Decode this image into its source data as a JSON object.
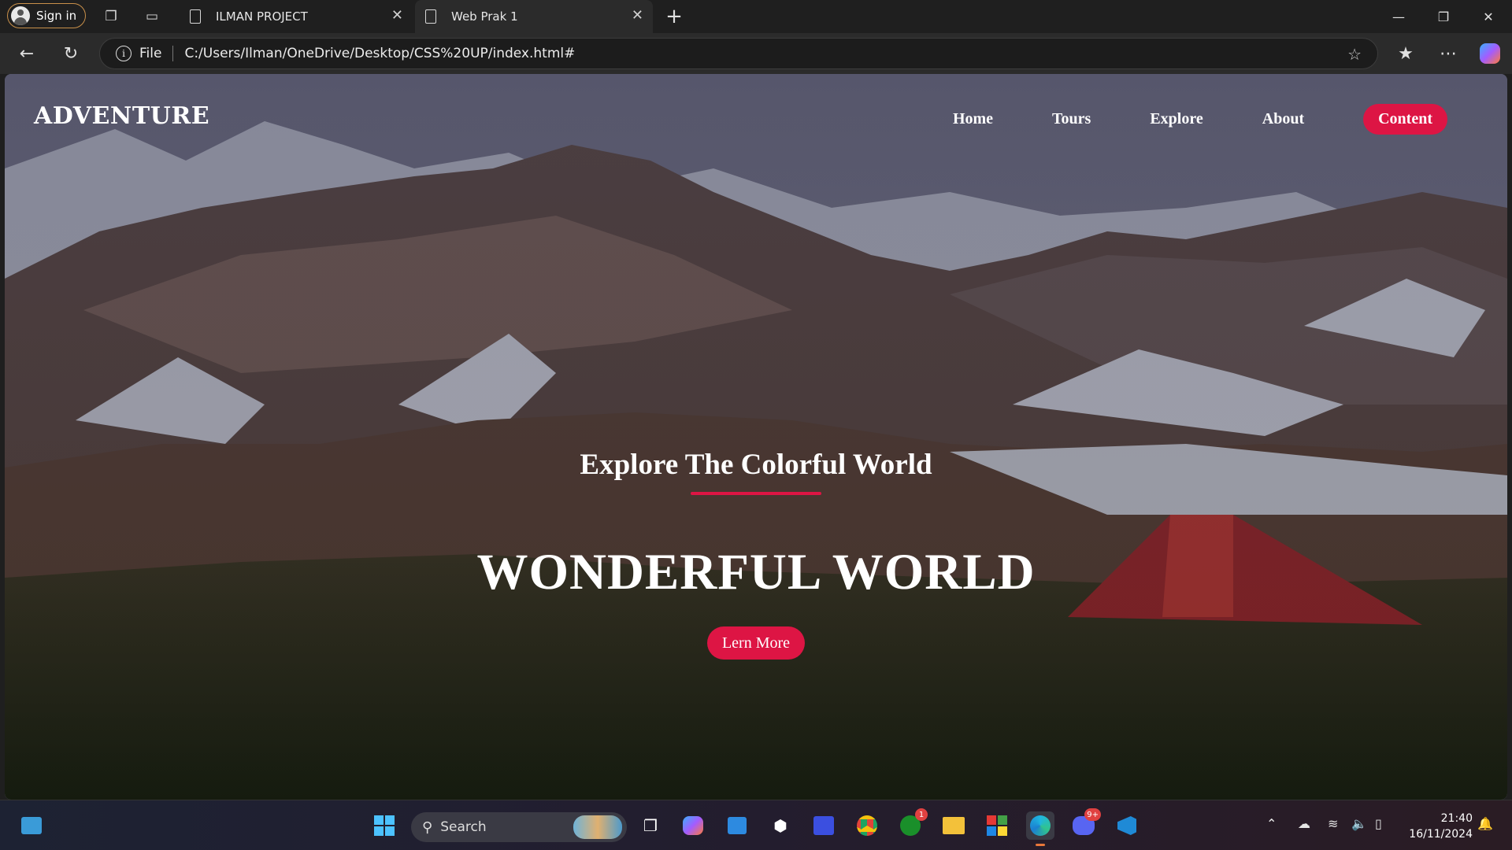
{
  "browser": {
    "signin_label": "Sign in",
    "tabs": [
      {
        "title": "ILMAN PROJECT"
      },
      {
        "title": "Web Prak 1"
      }
    ],
    "address": {
      "scheme": "File",
      "url": "C:/Users/Ilman/OneDrive/Desktop/CSS%20UP/index.html#"
    }
  },
  "site": {
    "brand": "ADVENTURE",
    "nav": [
      "Home",
      "Tours",
      "Explore",
      "About"
    ],
    "nav_cta": "Content",
    "hero": {
      "subtitle": "Explore The Colorful World",
      "title": "WONDERFUL WORLD",
      "button": "Lern More"
    },
    "accent_color": "#dd1544"
  },
  "taskbar": {
    "search_placeholder": "Search",
    "xbox_badge": "1",
    "discord_badge": "9+",
    "time": "21:40",
    "date": "16/11/2024"
  }
}
